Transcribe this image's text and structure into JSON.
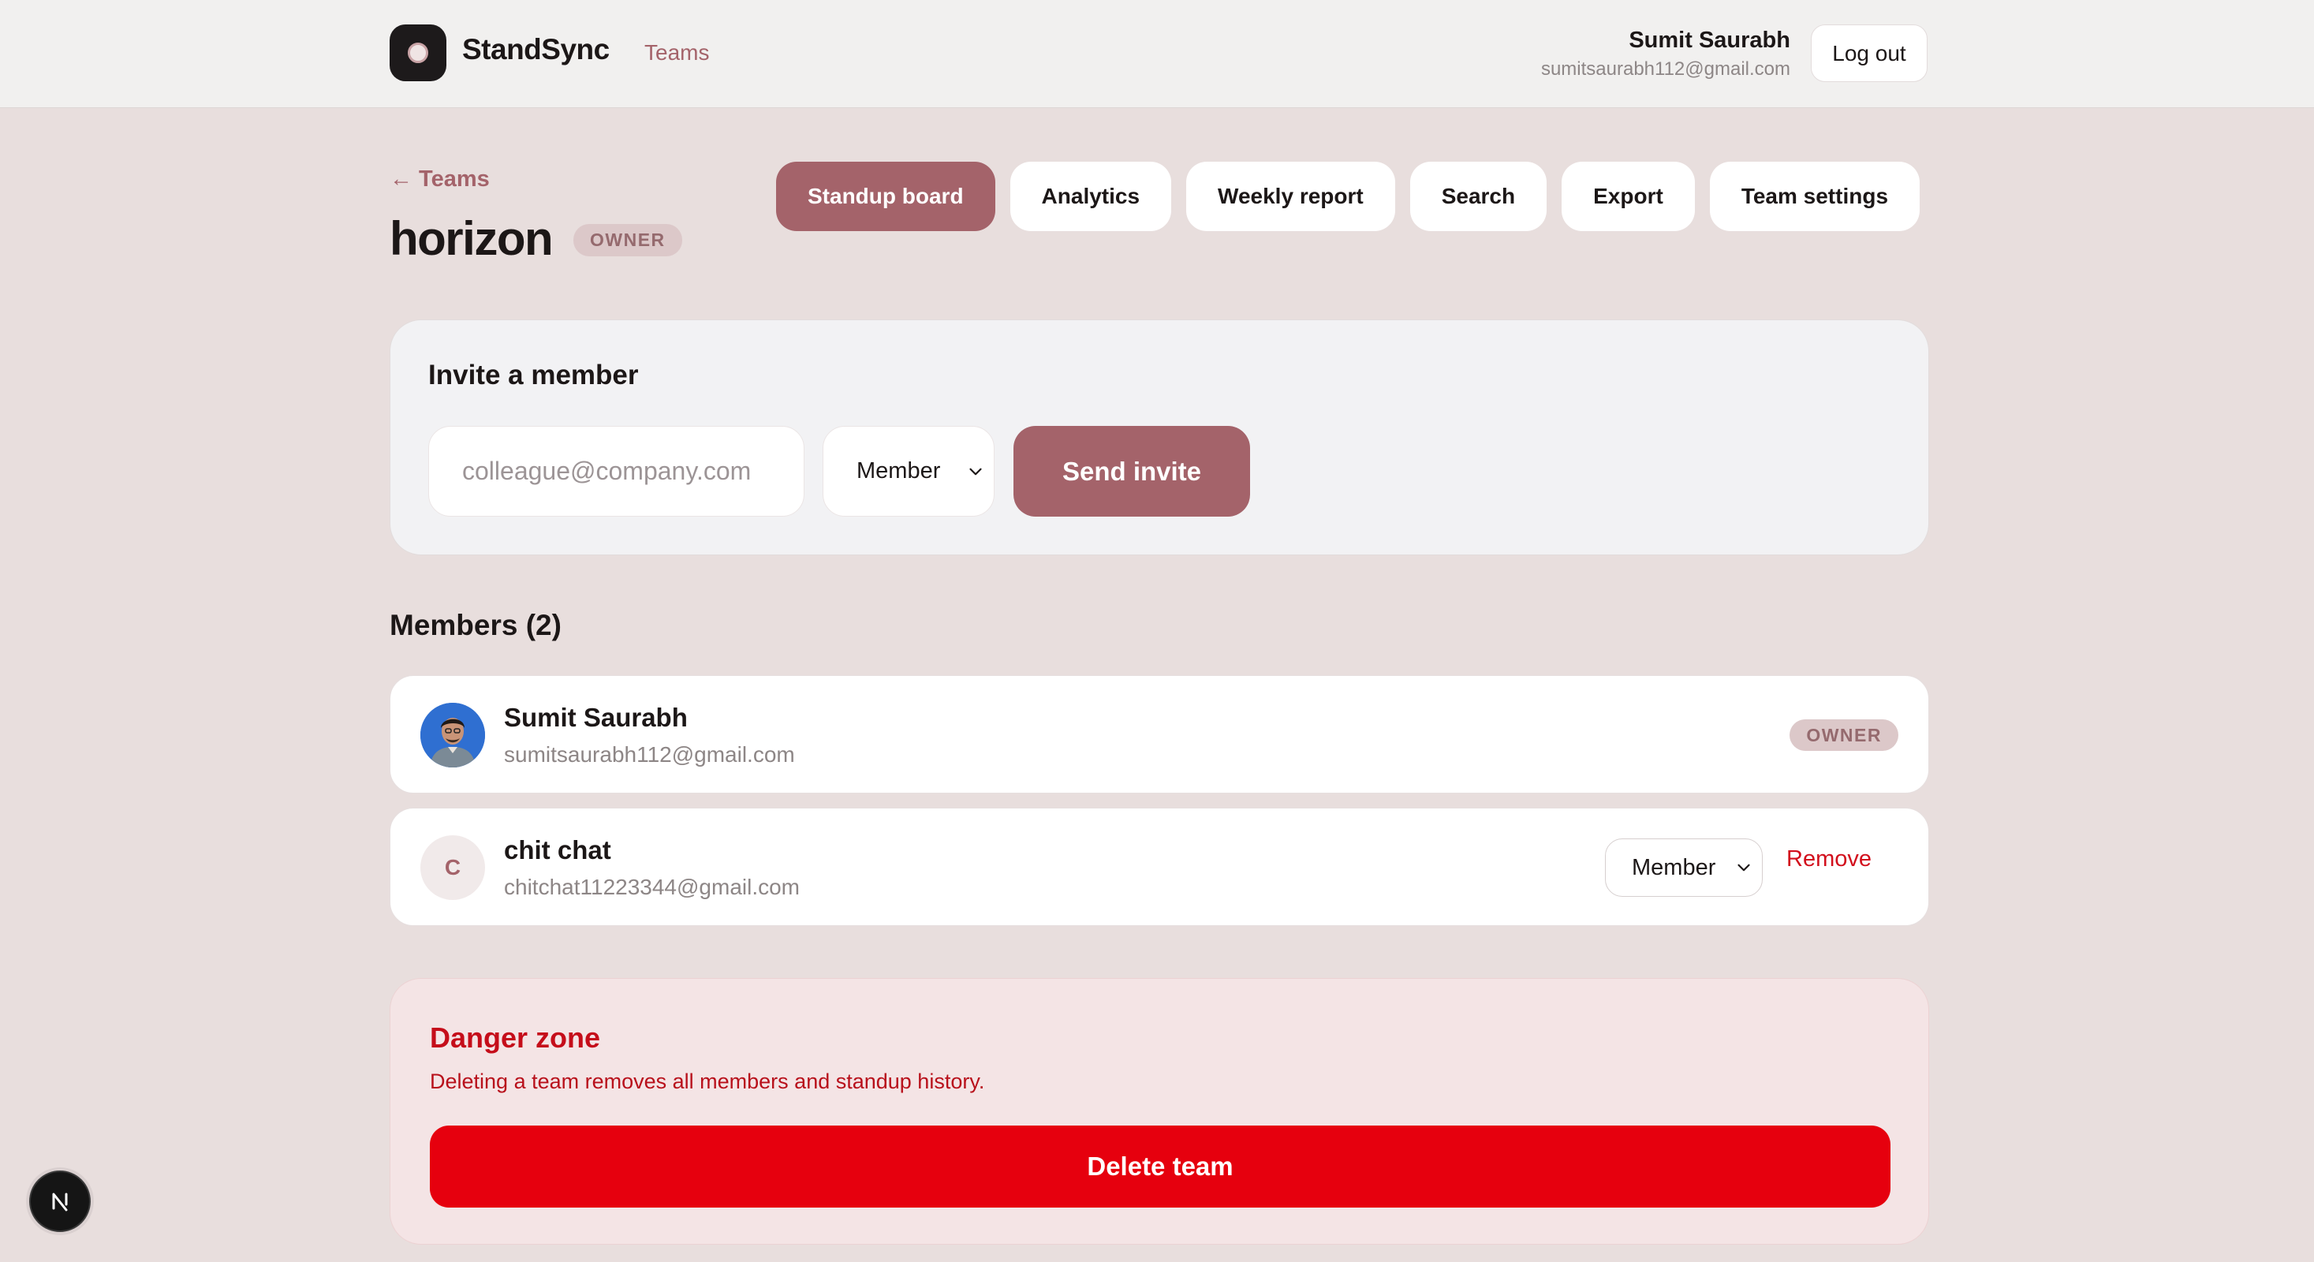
{
  "app": {
    "brand": "StandSync",
    "nav_teams": "Teams"
  },
  "user": {
    "name": "Sumit Saurabh",
    "email": "sumitsaurabh112@gmail.com",
    "logout_label": "Log out"
  },
  "header": {
    "back_label": "← Teams",
    "team_name": "horizon",
    "role_badge": "OWNER"
  },
  "tabs": [
    {
      "label": "Standup board",
      "active": true
    },
    {
      "label": "Analytics",
      "active": false
    },
    {
      "label": "Weekly report",
      "active": false
    },
    {
      "label": "Search",
      "active": false
    },
    {
      "label": "Export",
      "active": false
    },
    {
      "label": "Team settings",
      "active": false
    }
  ],
  "invite": {
    "heading": "Invite a member",
    "email_placeholder": "colleague@company.com",
    "email_value": "",
    "role_selected": "Member",
    "send_label": "Send invite"
  },
  "members": {
    "heading": "Members (2)",
    "list": [
      {
        "name": "Sumit Saurabh",
        "email": "sumitsaurabh112@gmail.com",
        "role_badge": "OWNER",
        "avatar": "photo"
      },
      {
        "name": "chit chat",
        "email": "chitchat11223344@gmail.com",
        "initial": "C",
        "role_selected": "Member",
        "remove_label": "Remove"
      }
    ]
  },
  "danger": {
    "title": "Danger zone",
    "text": "Deleting a team removes all members and standup history.",
    "delete_label": "Delete team"
  },
  "colors": {
    "accent": "#a4636a",
    "background": "#e8dedd",
    "danger": "#e6000e"
  },
  "icons": {
    "logo": "standsync-logo-icon",
    "chevron": "chevron-down-icon",
    "next_badge": "nextjs-icon"
  }
}
